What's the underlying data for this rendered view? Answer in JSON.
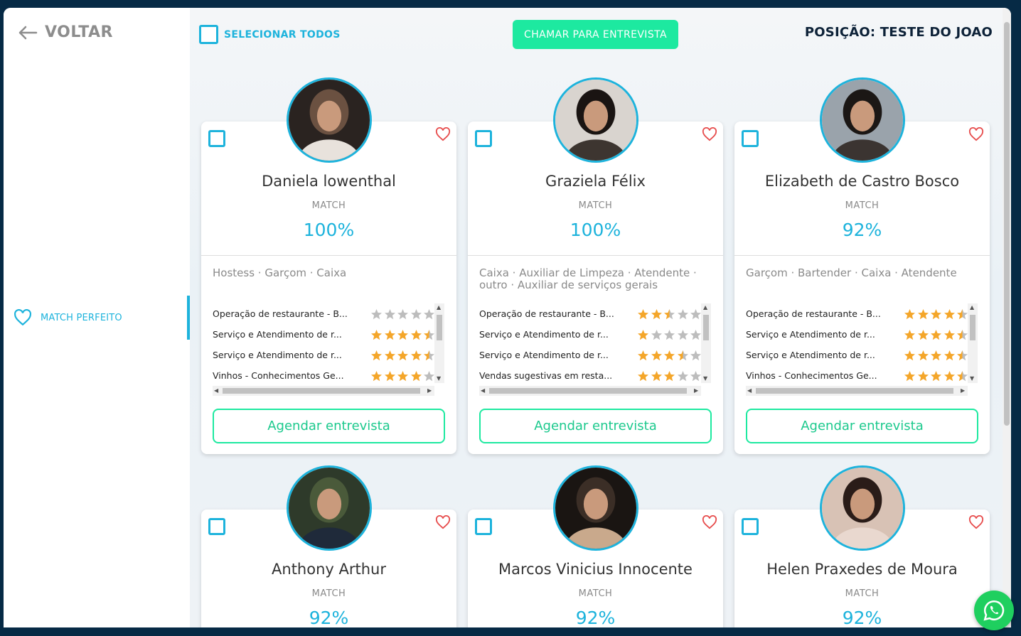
{
  "sidebar": {
    "back_label": "VOLTAR",
    "items": [
      {
        "label": "MATCH PERFEITO"
      }
    ]
  },
  "header": {
    "select_all_label": "SELECIONAR TODOS",
    "call_button_label": "CHAMAR PARA ENTREVISTA",
    "position_title": "POSIÇÃO: TESTE DO JOAO"
  },
  "colors": {
    "accent": "#1db3dc",
    "green": "#1de9a0",
    "heart": "#e74c4c",
    "star": "#f4a62a"
  },
  "candidates": [
    {
      "name": "Daniela lowenthal",
      "match_label": "MATCH",
      "match": "100%",
      "roles": "Hostess · Garçom · Caixa",
      "skills": [
        {
          "name": "Operação de restaurante - B...",
          "rating": 0
        },
        {
          "name": "Serviço e Atendimento de r...",
          "rating": 4.5
        },
        {
          "name": "Serviço e Atendimento de r...",
          "rating": 4.5
        },
        {
          "name": "Vinhos - Conhecimentos Ge...",
          "rating": 4
        }
      ],
      "button_label": "Agendar entrevista"
    },
    {
      "name": "Graziela Félix",
      "match_label": "MATCH",
      "match": "100%",
      "roles": "Caixa · Auxiliar de Limpeza · Atendente · outro · Auxiliar de serviços gerais",
      "skills": [
        {
          "name": "Operação de restaurante - B...",
          "rating": 2.5
        },
        {
          "name": "Serviço e Atendimento de r...",
          "rating": 1
        },
        {
          "name": "Serviço e Atendimento de r...",
          "rating": 3.5
        },
        {
          "name": "Vendas sugestivas em resta...",
          "rating": 3
        }
      ],
      "button_label": "Agendar entrevista"
    },
    {
      "name": "Elizabeth de Castro Bosco",
      "match_label": "MATCH",
      "match": "92%",
      "roles": "Garçom · Bartender · Caixa · Atendente",
      "skills": [
        {
          "name": "Operação de restaurante - B...",
          "rating": 4.5
        },
        {
          "name": "Serviço e Atendimento de r...",
          "rating": 4.5
        },
        {
          "name": "Serviço e Atendimento de r...",
          "rating": 4.5
        },
        {
          "name": "Vinhos - Conhecimentos Ge...",
          "rating": 4.5
        }
      ],
      "button_label": "Agendar entrevista"
    },
    {
      "name": "Anthony Arthur",
      "match_label": "MATCH",
      "match": "92%"
    },
    {
      "name": "Marcos Vinicius Innocente",
      "match_label": "MATCH",
      "match": "92%"
    },
    {
      "name": "Helen Praxedes de Moura",
      "match_label": "MATCH",
      "match": "92%"
    }
  ]
}
